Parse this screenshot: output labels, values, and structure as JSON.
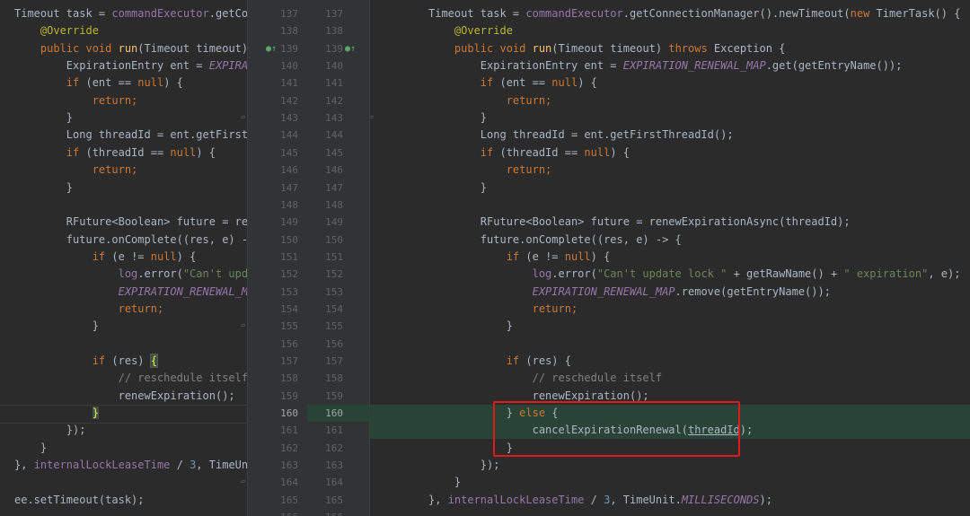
{
  "line_numbers": [
    "137",
    "138",
    "139",
    "140",
    "141",
    "142",
    "143",
    "144",
    "145",
    "146",
    "147",
    "148",
    "149",
    "150",
    "151",
    "152",
    "153",
    "154",
    "155",
    "156",
    "157",
    "158",
    "159",
    "160",
    "161",
    "162",
    "163",
    "164",
    "165",
    "166"
  ],
  "current_line": "160",
  "left": [
    [
      {
        "t": "Timeout task = "
      },
      {
        "t": "commandExecutor",
        "c": "t-fld"
      },
      {
        "t": ".getCo"
      }
    ],
    [
      {
        "t": "    "
      },
      {
        "t": "@Override",
        "c": "t-ann"
      }
    ],
    [
      {
        "t": "    "
      },
      {
        "t": "public void ",
        "c": "t-kw"
      },
      {
        "t": "run",
        "c": "t-fn"
      },
      {
        "t": "(Timeout timeout)"
      }
    ],
    [
      {
        "t": "        ExpirationEntry ent = "
      },
      {
        "t": "EXPIRA",
        "c": "t-const"
      }
    ],
    [
      {
        "t": "        "
      },
      {
        "t": "if ",
        "c": "t-kw"
      },
      {
        "t": "(ent == "
      },
      {
        "t": "null",
        "c": "t-kw"
      },
      {
        "t": ") {"
      }
    ],
    [
      {
        "t": "            "
      },
      {
        "t": "return;",
        "c": "t-kw"
      }
    ],
    [
      {
        "t": "        }"
      }
    ],
    [
      {
        "t": "        Long threadId = ent.getFirst"
      }
    ],
    [
      {
        "t": "        "
      },
      {
        "t": "if ",
        "c": "t-kw"
      },
      {
        "t": "(threadId == "
      },
      {
        "t": "null",
        "c": "t-kw"
      },
      {
        "t": ") {"
      }
    ],
    [
      {
        "t": "            "
      },
      {
        "t": "return;",
        "c": "t-kw"
      }
    ],
    [
      {
        "t": "        }"
      }
    ],
    [],
    [
      {
        "t": "        RFuture<Boolean> future = re"
      }
    ],
    [
      {
        "t": "        future.onComplete((res, e) -"
      }
    ],
    [
      {
        "t": "            "
      },
      {
        "t": "if ",
        "c": "t-kw"
      },
      {
        "t": "(e != "
      },
      {
        "t": "null",
        "c": "t-kw"
      },
      {
        "t": ") {"
      }
    ],
    [
      {
        "t": "                "
      },
      {
        "t": "log",
        "c": "t-fld"
      },
      {
        "t": ".error("
      },
      {
        "t": "\"Can't upd",
        "c": "t-str"
      }
    ],
    [
      {
        "t": "                "
      },
      {
        "t": "EXPIRATION_RENEWAL_M",
        "c": "t-const"
      }
    ],
    [
      {
        "t": "                "
      },
      {
        "t": "return;",
        "c": "t-kw"
      }
    ],
    [
      {
        "t": "            }"
      }
    ],
    [],
    [
      {
        "t": "            "
      },
      {
        "t": "if ",
        "c": "t-kw"
      },
      {
        "t": "(res) "
      },
      {
        "t": "{",
        "c": "t-brace-hl"
      }
    ],
    [
      {
        "t": "                "
      },
      {
        "t": "// reschedule itself",
        "c": "t-cmt"
      }
    ],
    [
      {
        "t": "                renewExpiration();"
      }
    ],
    [
      {
        "t": "            "
      },
      {
        "t": "}",
        "c": "t-brace-hl2"
      }
    ],
    [
      {
        "t": "        });"
      }
    ],
    [
      {
        "t": "    }"
      }
    ],
    [
      {
        "t": "}, "
      },
      {
        "t": "internalLockLeaseTime",
        "c": "t-fld"
      },
      {
        "t": " / "
      },
      {
        "t": "3",
        "c": "t-num"
      },
      {
        "t": ", TimeUn"
      }
    ],
    [],
    [
      {
        "t": "ee.setTimeout(task);"
      }
    ],
    []
  ],
  "right": [
    [
      {
        "t": "Timeout task = "
      },
      {
        "t": "commandExecutor",
        "c": "t-fld"
      },
      {
        "t": ".getConnectionManager().newTimeout("
      },
      {
        "t": "new ",
        "c": "t-kw"
      },
      {
        "t": "TimerTask() {"
      }
    ],
    [
      {
        "t": "    "
      },
      {
        "t": "@Override",
        "c": "t-ann"
      }
    ],
    [
      {
        "t": "    "
      },
      {
        "t": "public void ",
        "c": "t-kw"
      },
      {
        "t": "run",
        "c": "t-fn"
      },
      {
        "t": "(Timeout timeout) "
      },
      {
        "t": "throws ",
        "c": "t-kw"
      },
      {
        "t": "Exception {"
      }
    ],
    [
      {
        "t": "        ExpirationEntry ent = "
      },
      {
        "t": "EXPIRATION_RENEWAL_MAP",
        "c": "t-const"
      },
      {
        "t": ".get(getEntryName());"
      }
    ],
    [
      {
        "t": "        "
      },
      {
        "t": "if ",
        "c": "t-kw"
      },
      {
        "t": "(ent == "
      },
      {
        "t": "null",
        "c": "t-kw"
      },
      {
        "t": ") {"
      }
    ],
    [
      {
        "t": "            "
      },
      {
        "t": "return;",
        "c": "t-kw"
      }
    ],
    [
      {
        "t": "        }"
      }
    ],
    [
      {
        "t": "        Long threadId = ent.getFirstThreadId();"
      }
    ],
    [
      {
        "t": "        "
      },
      {
        "t": "if ",
        "c": "t-kw"
      },
      {
        "t": "(threadId == "
      },
      {
        "t": "null",
        "c": "t-kw"
      },
      {
        "t": ") {"
      }
    ],
    [
      {
        "t": "            "
      },
      {
        "t": "return;",
        "c": "t-kw"
      }
    ],
    [
      {
        "t": "        }"
      }
    ],
    [],
    [
      {
        "t": "        RFuture<Boolean> future = renewExpirationAsync(threadId);"
      }
    ],
    [
      {
        "t": "        future.onComplete((res, e) -> {"
      }
    ],
    [
      {
        "t": "            "
      },
      {
        "t": "if ",
        "c": "t-kw"
      },
      {
        "t": "(e != "
      },
      {
        "t": "null",
        "c": "t-kw"
      },
      {
        "t": ") {"
      }
    ],
    [
      {
        "t": "                "
      },
      {
        "t": "log",
        "c": "t-fld"
      },
      {
        "t": ".error("
      },
      {
        "t": "\"Can't update lock \"",
        "c": "t-str"
      },
      {
        "t": " + getRawName() + "
      },
      {
        "t": "\" expiration\"",
        "c": "t-str"
      },
      {
        "t": ", e);"
      }
    ],
    [
      {
        "t": "                "
      },
      {
        "t": "EXPIRATION_RENEWAL_MAP",
        "c": "t-const"
      },
      {
        "t": ".remove(getEntryName());"
      }
    ],
    [
      {
        "t": "                "
      },
      {
        "t": "return;",
        "c": "t-kw"
      }
    ],
    [
      {
        "t": "            }"
      }
    ],
    [],
    [
      {
        "t": "            "
      },
      {
        "t": "if ",
        "c": "t-kw"
      },
      {
        "t": "(res) {"
      }
    ],
    [
      {
        "t": "                "
      },
      {
        "t": "// reschedule itself",
        "c": "t-cmt"
      }
    ],
    [
      {
        "t": "                renewExpiration();"
      }
    ],
    [
      {
        "t": "            } "
      },
      {
        "t": "else ",
        "c": "t-kw"
      },
      {
        "t": "{"
      }
    ],
    [
      {
        "t": "                cancelExpirationRenewal("
      },
      {
        "t": "threadId",
        "c": "t-ul"
      },
      {
        "t": ");"
      }
    ],
    [
      {
        "t": "            }"
      }
    ],
    [
      {
        "t": "        });"
      }
    ],
    [
      {
        "t": "    }"
      }
    ],
    [
      {
        "t": "}, "
      },
      {
        "t": "internalLockLeaseTime",
        "c": "t-fld"
      },
      {
        "t": " / "
      },
      {
        "t": "3",
        "c": "t-num"
      },
      {
        "t": ", TimeUnit."
      },
      {
        "t": "MILLISECONDS",
        "c": "t-const"
      },
      {
        "t": ");"
      }
    ],
    []
  ],
  "changed_rows_right": [
    23,
    24
  ],
  "changed_rows_gutter": [
    23
  ],
  "run_marker_rows": [
    2
  ],
  "fold_rows_left": [
    6,
    18,
    27
  ],
  "fold_rows_right": [
    6
  ]
}
